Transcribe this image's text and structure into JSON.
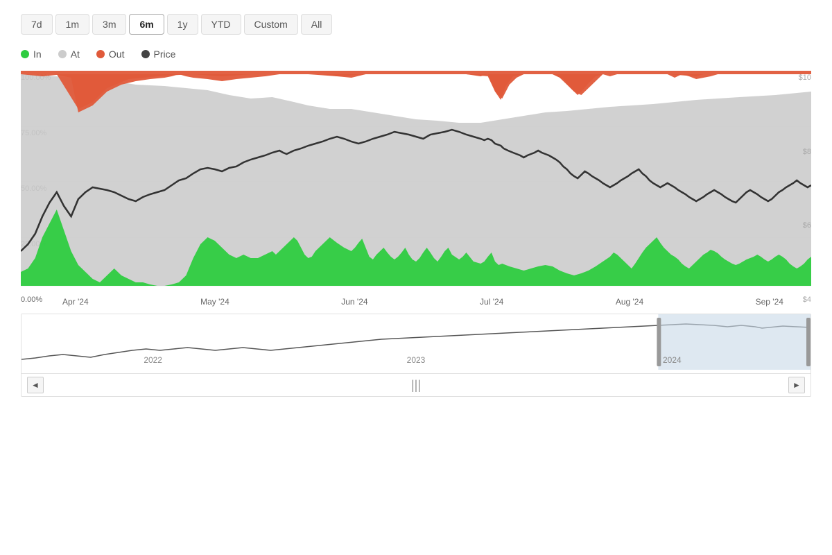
{
  "timeRange": {
    "buttons": [
      {
        "label": "7d",
        "active": false
      },
      {
        "label": "1m",
        "active": false
      },
      {
        "label": "3m",
        "active": false
      },
      {
        "label": "6m",
        "active": true
      },
      {
        "label": "1y",
        "active": false
      },
      {
        "label": "YTD",
        "active": false
      },
      {
        "label": "Custom",
        "active": false
      },
      {
        "label": "All",
        "active": false
      }
    ]
  },
  "legend": {
    "items": [
      {
        "label": "In",
        "color": "#2ecc40"
      },
      {
        "label": "At",
        "color": "#cccccc"
      },
      {
        "label": "Out",
        "color": "#e05a3a"
      },
      {
        "label": "Price",
        "color": "#444444"
      }
    ]
  },
  "yAxisLeft": [
    "100.00%",
    "75.00%",
    "50.00%",
    "25.00%",
    "0.00%"
  ],
  "yAxisRight": [
    "$10",
    "$8",
    "$6",
    "$4"
  ],
  "xAxisLabels": [
    "Apr '24",
    "May '24",
    "Jun '24",
    "Jul '24",
    "Aug '24",
    "Sep '24"
  ],
  "miniChartLabels": [
    "2022",
    "2023",
    "2024"
  ],
  "navButtons": {
    "prev": "◄",
    "next": "►",
    "center": "|||"
  },
  "colors": {
    "inColor": "#2ecc40",
    "atColor": "#cccccc",
    "outColor": "#e05a3a",
    "priceColor": "#444444",
    "navSelected": "#c8d8e8"
  }
}
